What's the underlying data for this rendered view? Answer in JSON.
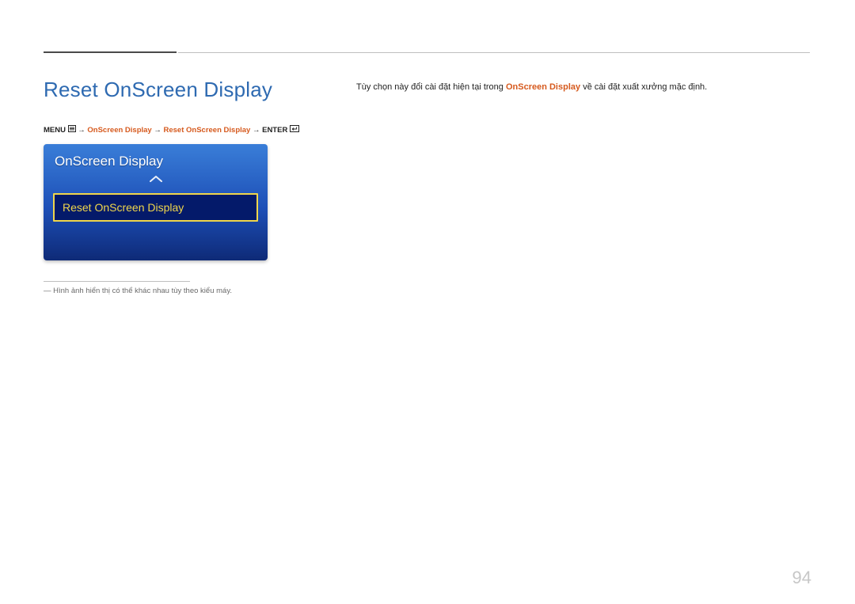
{
  "pageTitle": "Reset OnScreen Display",
  "breadcrumb": {
    "p1": "MENU ",
    "icon1": "menu-icon",
    "p2": " → ",
    "hl1": "OnScreen Display",
    "p3": " → ",
    "hl2": "Reset OnScreen Display",
    "p4": " → ",
    "p5": "ENTER ",
    "icon2": "enter-icon"
  },
  "menu": {
    "header": "OnScreen Display",
    "selected": "Reset OnScreen Display"
  },
  "footnote": "Hình ảnh hiển thị có thể khác nhau tùy theo kiểu máy.",
  "description": {
    "pre": "Tùy chọn này đổi cài đặt hiện tại trong",
    "hl": "OnScreen Display",
    "post": "về cài đặt xuất xưởng mặc định."
  },
  "pageNumber": "94"
}
